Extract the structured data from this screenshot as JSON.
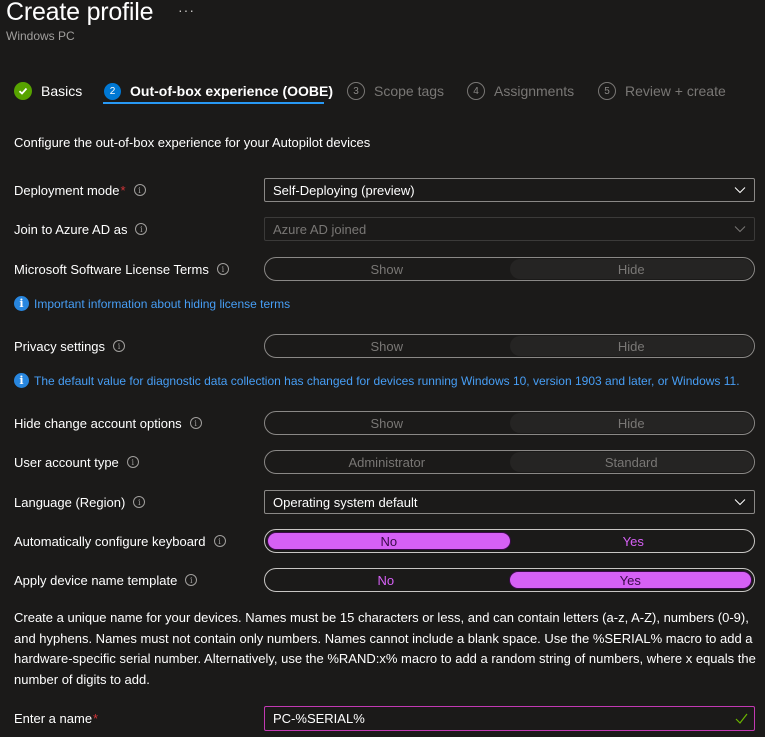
{
  "header": {
    "title": "Create profile",
    "more_label": "···",
    "subtitle": "Windows PC"
  },
  "steps": [
    {
      "number": "",
      "label": "Basics",
      "state": "done"
    },
    {
      "number": "2",
      "label": "Out-of-box experience (OOBE)",
      "state": "active"
    },
    {
      "number": "3",
      "label": "Scope tags",
      "state": "future"
    },
    {
      "number": "4",
      "label": "Assignments",
      "state": "future"
    },
    {
      "number": "5",
      "label": "Review + create",
      "state": "future"
    }
  ],
  "intro": "Configure the out-of-box experience for your Autopilot devices",
  "fields": {
    "deployment_mode": {
      "label": "Deployment mode",
      "required": "*",
      "value": "Self-Deploying (preview)"
    },
    "join_azure_ad": {
      "label": "Join to Azure AD as",
      "value": "Azure AD joined"
    },
    "license_terms": {
      "label": "Microsoft Software License Terms",
      "options": [
        "Show",
        "Hide"
      ],
      "selected": "Hide"
    },
    "license_info": "Important information about hiding license terms",
    "privacy": {
      "label": "Privacy settings",
      "options": [
        "Show",
        "Hide"
      ],
      "selected": "Hide"
    },
    "privacy_info": "The default value for diagnostic data collection has changed for devices running Windows 10, version 1903 and later, or Windows 11.",
    "hide_change_account": {
      "label": "Hide change account options",
      "options": [
        "Show",
        "Hide"
      ],
      "selected": "Hide"
    },
    "user_account_type": {
      "label": "User account type",
      "options": [
        "Administrator",
        "Standard"
      ],
      "selected": "Standard"
    },
    "language": {
      "label": "Language (Region)",
      "value": "Operating system default"
    },
    "auto_keyboard": {
      "label": "Automatically configure keyboard",
      "options": [
        "No",
        "Yes"
      ],
      "selected": "No"
    },
    "device_name_template": {
      "label": "Apply device name template",
      "options": [
        "No",
        "Yes"
      ],
      "selected": "Yes"
    },
    "name_description": "Create a unique name for your devices. Names must be 15 characters or less, and can contain letters (a-z, A-Z), numbers (0-9), and hyphens. Names must not contain only numbers. Names cannot include a blank space. Use the %SERIAL% macro to add a hardware-specific serial number. Alternatively, use the %RAND:x% macro to add a random string of numbers, where x equals the number of digits to add.",
    "enter_name": {
      "label": "Enter a name",
      "required": "*",
      "value": "PC-%SERIAL%"
    }
  },
  "colors": {
    "accent": "#d660f5",
    "step_active": "#0078d4",
    "step_done": "#57a300",
    "info": "#479ef5",
    "required": "#d13438"
  }
}
